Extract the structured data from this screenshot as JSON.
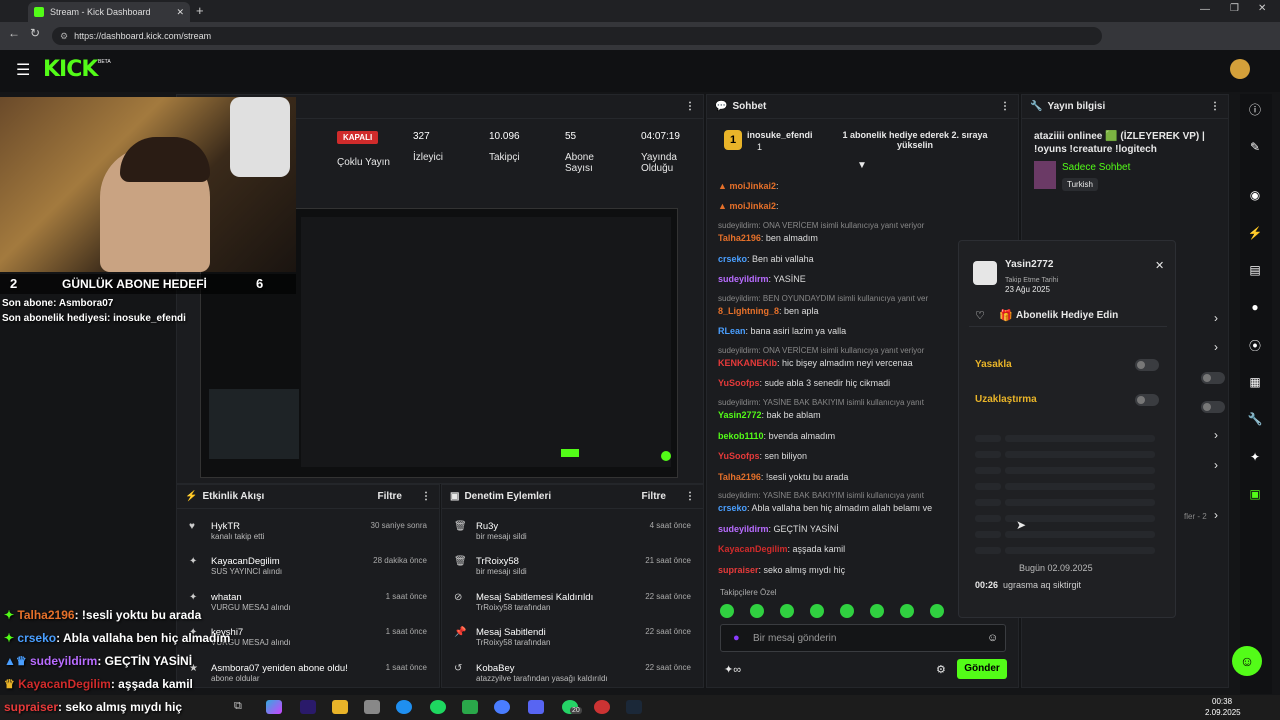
{
  "browser": {
    "tab_title": "Stream - Kick Dashboard",
    "url": "https://dashboard.kick.com/stream"
  },
  "header": {
    "logo": "KICK",
    "beta": "BETA"
  },
  "stream_stats": {
    "status": "KAPALI",
    "status_label": "Çoklu Yayın",
    "viewers": "327",
    "viewers_label": "İzleyici",
    "followers": "10.096",
    "followers_label": "Takipçi",
    "subs": "55",
    "subs_label": "Abone Sayısı",
    "uptime": "04:07:19",
    "uptime_label": "Yayında Olduğu"
  },
  "webcam_overlay": {
    "goal_count": "2",
    "goal_title": "GÜNLÜK ABONE HEDEFİ",
    "goal_target": "6",
    "last_sub": "Son abone: Asmbora07",
    "last_gift": "Son abonelik hediyesi: inosuke_efendi"
  },
  "activity": {
    "title": "Etkinlik Akışı",
    "filter": "Filtre",
    "items": [
      {
        "name": "HykTR",
        "desc": "kanalı takip etti",
        "time": "30 saniye sonra"
      },
      {
        "name": "KayacanDegilim",
        "desc": "SUS YAYINCI alındı",
        "time": "28 dakika önce"
      },
      {
        "name": "whatan",
        "desc": "VURGU MESAJ alındı",
        "time": "1 saat önce"
      },
      {
        "name": "keyshi7",
        "desc": "VURGU MESAJ alındı",
        "time": "1 saat önce"
      },
      {
        "name": "Asmbora07 yeniden abone oldu!",
        "desc": "abone oldular",
        "time": "1 saat önce"
      }
    ]
  },
  "moderation": {
    "title": "Denetim Eylemleri",
    "filter": "Filtre",
    "items": [
      {
        "name": "Ru3y",
        "desc": "bir mesajı sildi",
        "time": "4 saat önce"
      },
      {
        "name": "TrRoixy58",
        "desc": "bir mesajı sildi",
        "time": "21 saat önce"
      },
      {
        "name": "Mesaj Sabitlemesi Kaldırıldı",
        "desc": "TrRoixy58 tarafından",
        "time": "22 saat önce"
      },
      {
        "name": "Mesaj Sabitlendi",
        "desc": "TrRoixy58 tarafından",
        "time": "22 saat önce"
      },
      {
        "name": "KobaBey",
        "desc": "atazzyilve tarafından yasağı kaldırıldı",
        "time": "22 saat önce"
      }
    ]
  },
  "chat": {
    "title": "Sohbet",
    "pinned_user": "inosuke_efendi",
    "pinned_count": "1",
    "pinned_msg": "1 abonelik hediye ederek 2. sıraya yükselin",
    "followers_only": "Takipçilere Özel",
    "placeholder": "Bir mesaj gönderin",
    "send": "Gönder",
    "lines": [
      {
        "sys": "",
        "user": "moiJinkai2",
        "msg": ""
      },
      {
        "sys": "",
        "user": "moiJinkai2",
        "msg": ""
      },
      {
        "sys": "sudeyildirm: ONA VERİCEM isimli kullanıcıya yanıt veriyor",
        "user": "Talha2196",
        "msg": "ben almadım"
      },
      {
        "sys": "",
        "user": "crseko",
        "msg": "Ben abi vallaha"
      },
      {
        "sys": "",
        "user": "sudeyildirm",
        "msg": "YASİNE"
      },
      {
        "sys": "sudeyildirm: BEN OYUNDAYDIM isimli kullanıcıya yanıt ver",
        "user": "8_Lightning_8",
        "msg": "ben apla"
      },
      {
        "sys": "",
        "user": "RLean",
        "msg": "bana asiri lazim ya valla"
      },
      {
        "sys": "sudeyildirm: ONA VERİCEM isimli kullanıcıya yanıt veriyor",
        "user": "KENKANEKib",
        "msg": "hic bişey almadım neyi vercenaa"
      },
      {
        "sys": "",
        "user": "YuSoofps",
        "msg": "sude abla 3 senedir hiç cikmadi"
      },
      {
        "sys": "sudeyildirm: YASİNE BAK BAKIYIM isimli kullanıcıya yanıt",
        "user": "Yasin2772",
        "msg": "bak be ablam"
      },
      {
        "sys": "",
        "user": "bekob1110",
        "msg": "bvenda almadım"
      },
      {
        "sys": "",
        "user": "YuSoofps",
        "msg": "sen biliyon"
      },
      {
        "sys": "",
        "user": "Talha2196",
        "msg": "!sesli yoktu bu arada"
      },
      {
        "sys": "sudeyildirm: YASİNE BAK BAKIYIM isimli kullanıcıya yanıt",
        "user": "crseko",
        "msg": "Abla vallaha ben hiç almadım allah belamı ve"
      },
      {
        "sys": "",
        "user": "sudeyildirm",
        "msg": "GEÇTİN YASİNİ"
      },
      {
        "sys": "",
        "user": "KayacanDegilim",
        "msg": "aşşada kamil"
      },
      {
        "sys": "",
        "user": "supraiser",
        "msg": "seko almış mıydı hiç"
      }
    ]
  },
  "stream_info": {
    "title": "Yayın bilgisi",
    "stream_title": "ataziiii onlinee 🟩 (İZLEYEREK VP) | !oyuns !creature !logitech",
    "category": "Sadece Sohbet",
    "tag": "Turkish",
    "pager": "fler - 2"
  },
  "user_popup": {
    "username": "Yasin2772",
    "follow_label": "Takip Etme Tarihi",
    "follow_date": "23 Ağu 2025",
    "gift": "Abonelik Hediye Edin",
    "ban": "Yasakla",
    "timeout": "Uzaklaştırma",
    "date_sep": "Bugün 02.09.2025",
    "log_time": "00:26",
    "log_msg": "ugrasma aq siktirgit"
  },
  "stream_chat_overlay": [
    {
      "user": "Talha2196",
      "msg": ": !sesli yoktu bu arada"
    },
    {
      "user": "crseko",
      "msg": ": Abla vallaha ben hiç almadım"
    },
    {
      "user": "sudeyildirm",
      "msg": ": GEÇTİN YASİNİ"
    },
    {
      "user": "KayacanDegilim",
      "msg": ": aşşada kamil"
    },
    {
      "user": "supraiser",
      "msg": ": seko almış mıydı hiç"
    }
  ],
  "taskbar": {
    "time": "00:38",
    "date": "2.09.2025",
    "badge": "20"
  },
  "colors": {
    "kick_green": "#53fc18",
    "red": "#d02b2b",
    "orange": "#e5702a"
  }
}
